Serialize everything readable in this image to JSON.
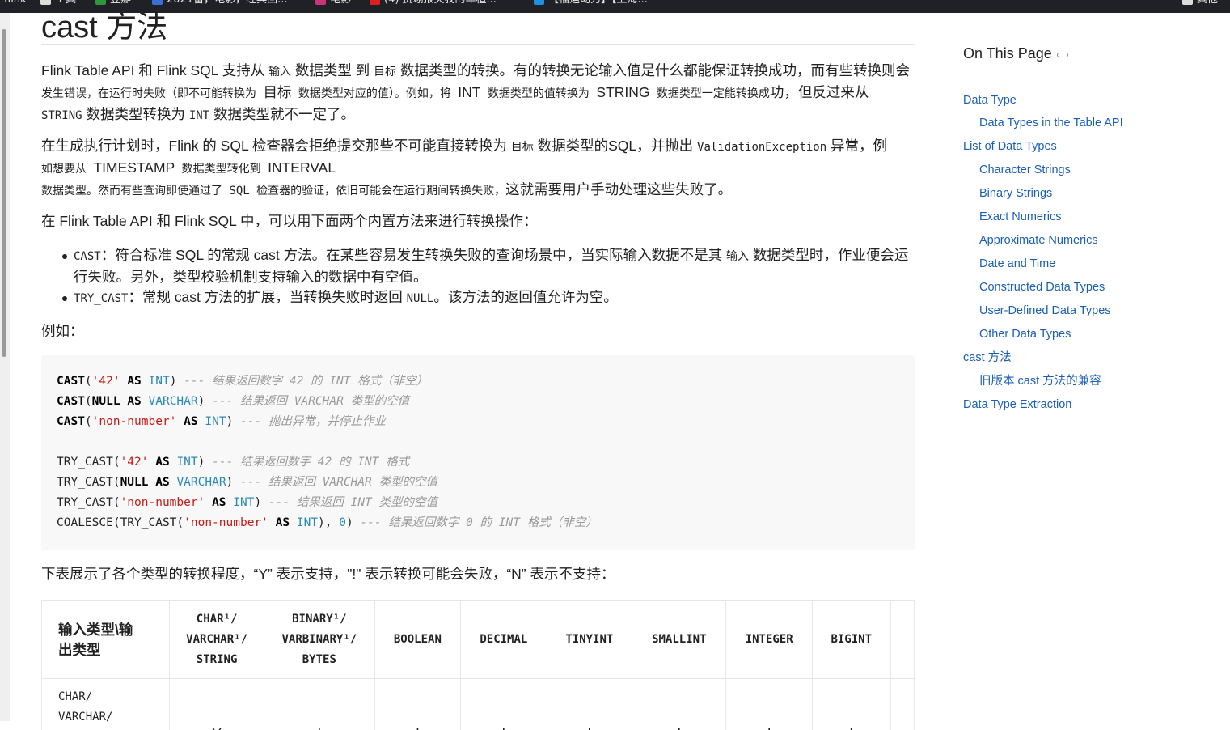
{
  "bookmarks": [
    {
      "label": "flink",
      "icon": "text"
    },
    {
      "label": "工具",
      "icon": "folder-icon"
    },
    {
      "label": "豆瓣",
      "icon": "douban-icon"
    },
    {
      "label": "2021留，电影，经典回...",
      "icon": "globe-icon"
    },
    {
      "label": "电影",
      "icon": "movie-icon"
    },
    {
      "label": "(4) 贾翊报关我的车植...",
      "icon": "youtube-icon"
    },
    {
      "label": "【福运动力】【上海...",
      "icon": "tv-icon"
    },
    {
      "label": "其他",
      "icon": "folder-icon"
    }
  ],
  "article": {
    "title": "cast 方法",
    "p1": [
      "Flink Table API 和 Flink SQL 支持从 ",
      "输入",
      " 数据类型 到 ",
      "目标",
      " 数据类型的转换。有的转换无论输入值是什么都能保证转换成功，而有些转换则会",
      "发生错误，在运行时失败（即不可能转换为 ",
      "目标",
      " 数据类型对应的值）。例如，将 ",
      "INT",
      " 数据类型的值转换为 ",
      "STRING",
      " 数据类型一定能转换成",
      "功，但反过来从 ",
      "STRING",
      " 数据类型转换为 ",
      "INT",
      " 数据类型就不一定了。"
    ],
    "p2": [
      "在生成执行计划时，Flink 的 SQL 检查器会拒绝提交那些不可能直接转换为 ",
      "目标",
      " 数据类型的SQL，并抛出 ",
      "ValidationException",
      " 异常，例",
      "如想要从 ",
      "TIMESTAMP",
      " 数据类型转化到 ",
      "INTERVAL",
      " 数据类型。然而有些查询即使通过了 SQL 检查器的验证，依旧可能会在运行期间转换失败，",
      "这就需要用户手动处理这些失败了。"
    ],
    "p3": "在 Flink Table API 和 Flink SQL 中，可以用下面两个内置方法来进行转换操作：",
    "bullets": [
      {
        "code": "CAST",
        "text": "：符合标准 SQL 的常规 cast 方法。在某些容易发生转换失败的查询场景中，当实际输入数据不是其 ",
        "code2": "输入",
        "text2": " 数据类型时，作业便会运",
        "text3": "行失败。另外，类型校验机制支持输入的数据中有空值。"
      },
      {
        "code": "TRY_CAST",
        "text": "：常规 cast 方法的扩展，当转换失败时返回 ",
        "code2": "NULL",
        "text2": "。该方法的返回值允许为空。",
        "text3": ""
      }
    ],
    "p4": "例如：",
    "code_lines": [
      [
        [
          "kw",
          "CAST"
        ],
        [
          "p",
          "("
        ],
        [
          "str",
          "'42'"
        ],
        [
          "p",
          " "
        ],
        [
          "kw",
          "AS"
        ],
        [
          "p",
          " "
        ],
        [
          "typ",
          "INT"
        ],
        [
          "p",
          ") "
        ],
        [
          "cm",
          "--- 结果返回数字 42 的 INT 格式（非空）"
        ]
      ],
      [
        [
          "kw",
          "CAST"
        ],
        [
          "p",
          "("
        ],
        [
          "kw",
          "NULL"
        ],
        [
          "p",
          " "
        ],
        [
          "kw",
          "AS"
        ],
        [
          "p",
          " "
        ],
        [
          "typ",
          "VARCHAR"
        ],
        [
          "p",
          ") "
        ],
        [
          "cm",
          "--- 结果返回 VARCHAR 类型的空值"
        ]
      ],
      [
        [
          "kw",
          "CAST"
        ],
        [
          "p",
          "("
        ],
        [
          "str",
          "'non-number'"
        ],
        [
          "p",
          " "
        ],
        [
          "kw",
          "AS"
        ],
        [
          "p",
          " "
        ],
        [
          "typ",
          "INT"
        ],
        [
          "p",
          ") "
        ],
        [
          "cm",
          "--- 抛出异常，并停止作业"
        ]
      ],
      [],
      [
        [
          "p",
          "TRY_CAST("
        ],
        [
          "str",
          "'42'"
        ],
        [
          "p",
          " "
        ],
        [
          "kw",
          "AS"
        ],
        [
          "p",
          " "
        ],
        [
          "typ",
          "INT"
        ],
        [
          "p",
          ") "
        ],
        [
          "cm",
          "--- 结果返回数字 42 的 INT 格式"
        ]
      ],
      [
        [
          "p",
          "TRY_CAST("
        ],
        [
          "kw",
          "NULL"
        ],
        [
          "p",
          " "
        ],
        [
          "kw",
          "AS"
        ],
        [
          "p",
          " "
        ],
        [
          "typ",
          "VARCHAR"
        ],
        [
          "p",
          ") "
        ],
        [
          "cm",
          "--- 结果返回 VARCHAR 类型的空值"
        ]
      ],
      [
        [
          "p",
          "TRY_CAST("
        ],
        [
          "str",
          "'non-number'"
        ],
        [
          "p",
          " "
        ],
        [
          "kw",
          "AS"
        ],
        [
          "p",
          " "
        ],
        [
          "typ",
          "INT"
        ],
        [
          "p",
          ") "
        ],
        [
          "cm",
          "--- 结果返回 INT 类型的空值"
        ]
      ],
      [
        [
          "p",
          "COALESCE(TRY_CAST("
        ],
        [
          "str",
          "'non-number'"
        ],
        [
          "p",
          " "
        ],
        [
          "kw",
          "AS"
        ],
        [
          "p",
          " "
        ],
        [
          "typ",
          "INT"
        ],
        [
          "p",
          "), "
        ],
        [
          "num",
          "0"
        ],
        [
          "p",
          ") "
        ],
        [
          "cm",
          "--- 结果返回数字 0 的 INT 格式（非空）"
        ]
      ]
    ],
    "p5": "下表展示了各个类型的转换程度，“Y” 表示支持，\"!\" 表示转换可能会失败，“N” 表示不支持：",
    "table": {
      "corner": "输入类型\\输出类型",
      "headers": [
        {
          "lines": [
            "CHAR¹/",
            "VARCHAR¹/",
            "STRING"
          ]
        },
        {
          "lines": [
            "BINARY¹/",
            "VARBINARY¹/",
            "BYTES"
          ]
        },
        {
          "lines": [
            "BOOLEAN"
          ]
        },
        {
          "lines": [
            "DECIMAL"
          ]
        },
        {
          "lines": [
            "TINYINT"
          ]
        },
        {
          "lines": [
            "SMALLINT"
          ]
        },
        {
          "lines": [
            "INTEGER"
          ]
        },
        {
          "lines": [
            "BIGINT"
          ]
        }
      ],
      "rows": [
        {
          "head": [
            "CHAR/",
            "VARCHAR/"
          ],
          "cells": [
            "Y",
            "!",
            "!",
            "!",
            "!",
            "!",
            "!",
            "!"
          ]
        }
      ]
    }
  },
  "toc": {
    "title": "On This Page",
    "items": [
      {
        "label": "Data Type",
        "level": 1
      },
      {
        "label": "Data Types in the Table API",
        "level": 2
      },
      {
        "label": "List of Data Types",
        "level": 1
      },
      {
        "label": "Character Strings",
        "level": 2
      },
      {
        "label": "Binary Strings",
        "level": 2
      },
      {
        "label": "Exact Numerics",
        "level": 2
      },
      {
        "label": "Approximate Numerics",
        "level": 2
      },
      {
        "label": "Date and Time",
        "level": 2
      },
      {
        "label": "Constructed Data Types",
        "level": 2
      },
      {
        "label": "User-Defined Data Types",
        "level": 2
      },
      {
        "label": "Other Data Types",
        "level": 2
      },
      {
        "label": "cast 方法",
        "level": 1
      },
      {
        "label": "旧版本 cast 方法的兼容",
        "level": 2
      },
      {
        "label": "Data Type Extraction",
        "level": 1
      }
    ]
  }
}
